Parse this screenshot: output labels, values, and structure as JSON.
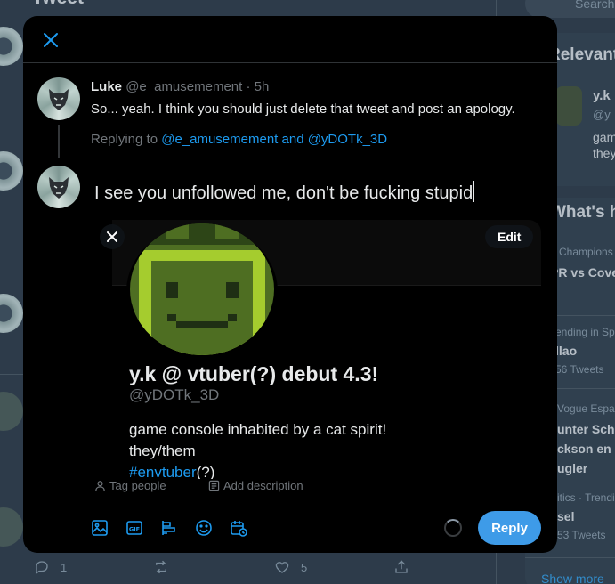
{
  "background": {
    "feed_title": "Tweet",
    "actions": {
      "reply_count": "1",
      "like_count": "5"
    },
    "search_placeholder": "Search",
    "relevant": {
      "title": "Relevant",
      "name": "y.k",
      "handle": "@y",
      "bio_line1": "gam",
      "bio_line2": "they"
    },
    "whats_happening": {
      "title": "What's h",
      "trends": [
        {
          "meta": "Champions",
          "name": "PR vs Cove",
          "count": ""
        },
        {
          "meta": "ending in Spa",
          "name": "llao",
          "count": "56 Tweets"
        },
        {
          "meta": "Vogue Espa",
          "name": "unter Scha",
          "name2": "ckson en s",
          "name3": "ugler",
          "count": ""
        },
        {
          "meta": "itics · Trendi",
          "name": "sel",
          "count": "53 Tweets"
        }
      ],
      "show_more": "Show more"
    }
  },
  "modal": {
    "original": {
      "name": "Luke",
      "handle_time": "@e_amusemement · 5h",
      "text": "So... yeah. I think you should just delete that tweet and post an apology.",
      "replying_prefix": "Replying to",
      "replying_to": "@e_amusemement and @yDOTk_3D"
    },
    "compose_text": "I see you unfollowed me, don't be fucking stupid",
    "attachment": {
      "edit_label": "Edit",
      "display_name": "y.k @ vtuber(?) debut 4.3!",
      "handle": "@yDOTk_3D",
      "bio_line1": "game console inhabited by a cat spirit!",
      "bio_line2": "they/them",
      "bio_line3_link": "#envtuber",
      "bio_line3_suffix": "(?)"
    },
    "tag_people": "Tag people",
    "add_description": "Add description",
    "reply_label": "Reply",
    "colors": {
      "accent": "#1d9bf0",
      "reply_button": "#3e9be8",
      "modal_bg": "#000000",
      "app_bg": "#15202b"
    }
  }
}
